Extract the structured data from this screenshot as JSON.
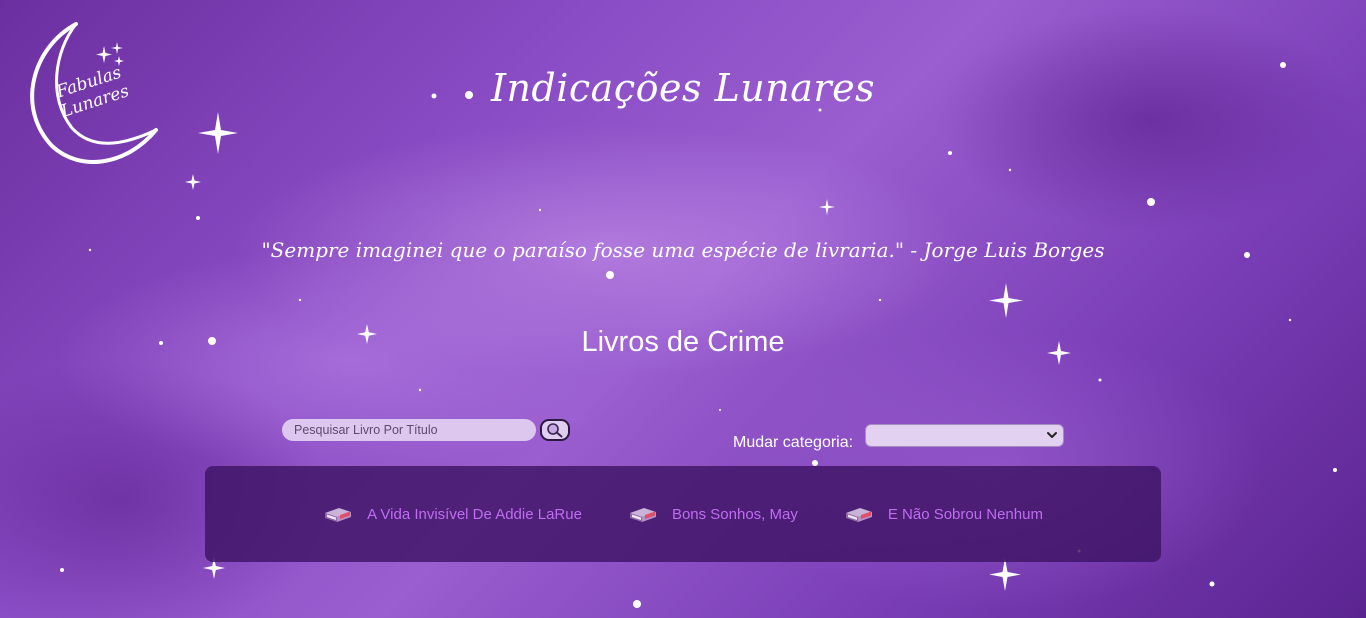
{
  "logo": {
    "line1": "Fabulas",
    "line2": "Lunares"
  },
  "header": {
    "title": "Indicações Lunares"
  },
  "quote": {
    "text": "\"Sempre imaginei que o paraíso fosse uma espécie de livraria.\" - Jorge Luis Borges"
  },
  "category": {
    "title": "Livros de Crime"
  },
  "search": {
    "placeholder": "Pesquisar Livro Por Título",
    "value": "",
    "button_icon": "magnifier-icon"
  },
  "category_select": {
    "label": "Mudar categoria:",
    "selected": ""
  },
  "books": [
    {
      "title": "A Vida Invisível De Addie LaRue",
      "icon": "book-stack-icon"
    },
    {
      "title": "Bons Sonhos, May",
      "icon": "book-stack-icon"
    },
    {
      "title": "E Não Sobrou Nenhum",
      "icon": "book-stack-icon"
    }
  ],
  "colors": {
    "background": "#8a4cc4",
    "panel": "#3e1464",
    "link": "#c06cf0",
    "text": "#ffffff"
  }
}
